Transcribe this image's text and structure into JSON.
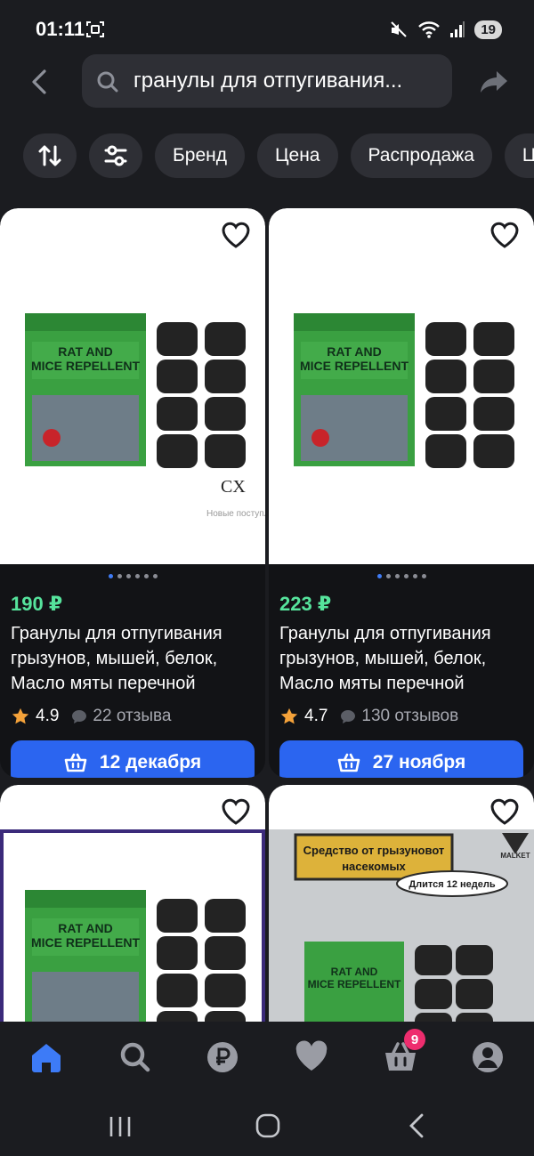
{
  "status": {
    "time": "01:11",
    "battery": "19"
  },
  "search": {
    "query": "гранулы для отпугивания..."
  },
  "filters": {
    "chips": [
      "Бренд",
      "Цена",
      "Распродажа",
      "Ц"
    ]
  },
  "products": [
    {
      "price": "190 ₽",
      "title": "Гранулы для отпугивания грызунов, мышей, белок, Масло мяты перечной",
      "rating": "4.9",
      "reviews": "22 отзыва",
      "delivery": "12 декабря",
      "image_box_title": "RAT AND MICE REPELLENT",
      "image_caption": "CX",
      "image_subcaption": "Новые поступл"
    },
    {
      "price": "223 ₽",
      "title": "Гранулы для отпугивания грызунов, мышей, белок, Масло мяты перечной",
      "rating": "4.7",
      "reviews": "130 отзывов",
      "delivery": "27 ноября",
      "image_box_title": "RAT AND MICE REPELLENT"
    },
    {
      "image_box_title": "RAT AND MICE REPELLENT"
    },
    {
      "image_box_title": "RAT AND MICE REPELLENT",
      "banner_text": "Средство от грызуновот насекомых",
      "bubble_text": "Длится 12 недель",
      "logo_text": "MALKET"
    }
  ],
  "bottom_nav": {
    "cart_count": "9",
    "items": [
      "home-icon",
      "search-icon",
      "ruble-icon",
      "heart-icon",
      "cart-icon",
      "profile-icon"
    ]
  },
  "colors": {
    "background": "#1b1c20",
    "card": "#121316",
    "price_green": "#56e39c",
    "accent_blue": "#2b65f0",
    "badge_pink": "#ee2d6e",
    "star": "#f4a23a"
  }
}
